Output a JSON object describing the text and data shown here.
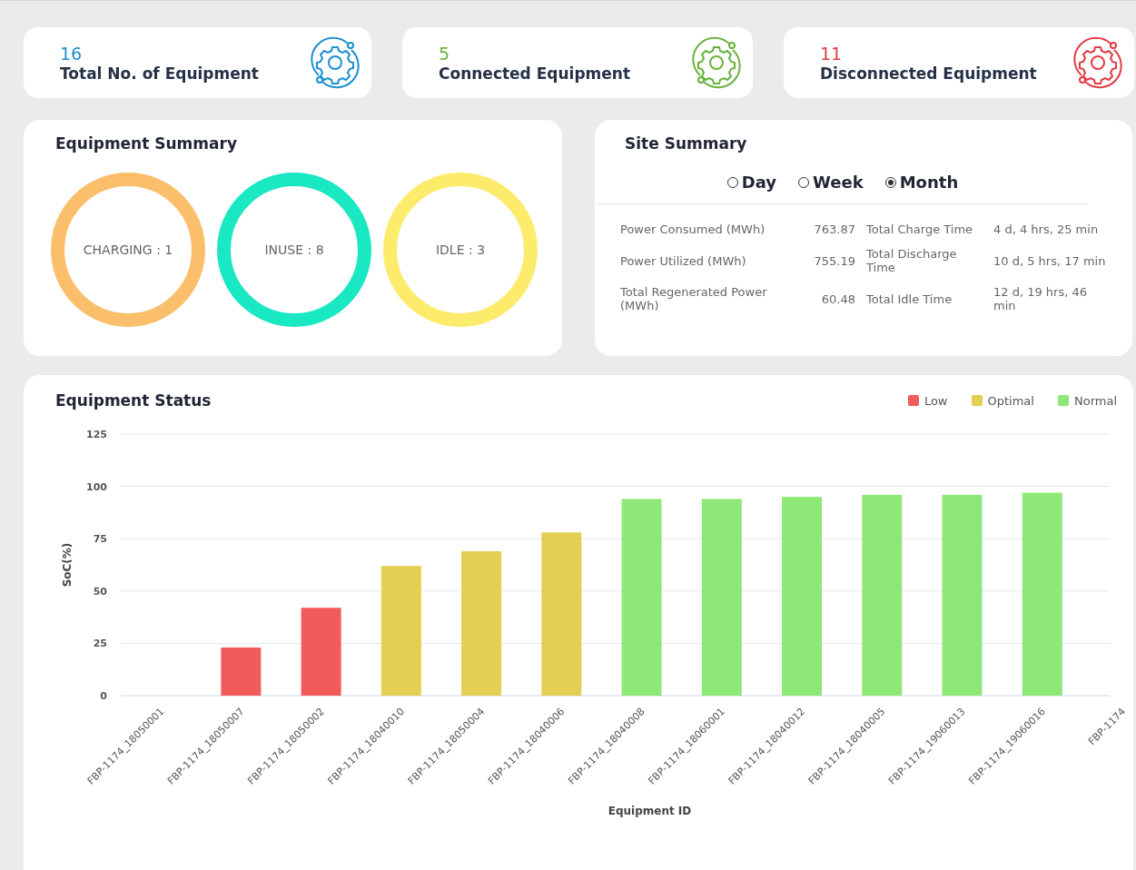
{
  "stat_cards": [
    {
      "count": "16",
      "label": "Total No. of Equipment",
      "color": "#1a8fd1"
    },
    {
      "count": "5",
      "label": "Connected Equipment",
      "color": "#6ab23a"
    },
    {
      "count": "11",
      "label": "Disconnected Equipment",
      "color": "#e33b45"
    }
  ],
  "equipment_summary": {
    "title": "Equipment Summary",
    "rings": [
      {
        "label": "CHARGING : 1",
        "color": "#fbbf6b"
      },
      {
        "label": "INUSE : 8",
        "color": "#19e8c2"
      },
      {
        "label": "IDLE : 3",
        "color": "#fdeb6c"
      }
    ]
  },
  "site_summary": {
    "title": "Site Summary",
    "periods": [
      {
        "label": "Day",
        "selected": false
      },
      {
        "label": "Week",
        "selected": false
      },
      {
        "label": "Month",
        "selected": true
      }
    ],
    "rows": [
      {
        "label": "Power Consumed (MWh)",
        "value": "763.87",
        "label_2": "Total Charge Time",
        "value_2": "4 d, 4 hrs, 25 min"
      },
      {
        "label": "Power Utilized (MWh)",
        "value": "755.19",
        "label_2": "Total Discharge Time",
        "value_2": "10 d, 5 hrs, 17 min"
      },
      {
        "label": "Total Regenerated Power (MWh)",
        "value": "60.48",
        "label_2": "Total Idle Time",
        "value_2": "12 d, 19 hrs, 46 min"
      }
    ]
  },
  "equipment_status": {
    "title": "Equipment Status",
    "chart_data": {
      "type": "bar",
      "xlabel": "Equipment ID",
      "ylabel": "SoC(%)",
      "categories": [
        "FBP-1174_18050001",
        "FBP-1174_18050007",
        "FBP-1174_18050002",
        "FBP-1174_18040010",
        "FBP-1174_18050004",
        "FBP-1174_18040006",
        "FBP-1174_18040008",
        "FBP-1174_18060001",
        "FBP-1174_18040012",
        "FBP-1174_18040005",
        "FBP-1174_19060013",
        "FBP-1174_19060016",
        "FBP-1174"
      ],
      "series": [
        {
          "name": "Low",
          "color": "#f25b5b",
          "values": [
            0,
            23,
            42,
            null,
            null,
            null,
            null,
            null,
            null,
            null,
            null,
            null,
            null
          ]
        },
        {
          "name": "Optimal",
          "color": "#e3d052",
          "values": [
            null,
            null,
            null,
            62,
            69,
            78,
            null,
            null,
            null,
            null,
            null,
            null,
            null
          ]
        },
        {
          "name": "Normal",
          "color": "#8ee878",
          "values": [
            null,
            null,
            null,
            null,
            null,
            null,
            94,
            94,
            95,
            96,
            96,
            97,
            null
          ]
        }
      ],
      "grid": true,
      "ylim": [
        0,
        125
      ],
      "yticks": [
        0,
        25,
        50,
        75,
        100,
        125
      ]
    }
  }
}
